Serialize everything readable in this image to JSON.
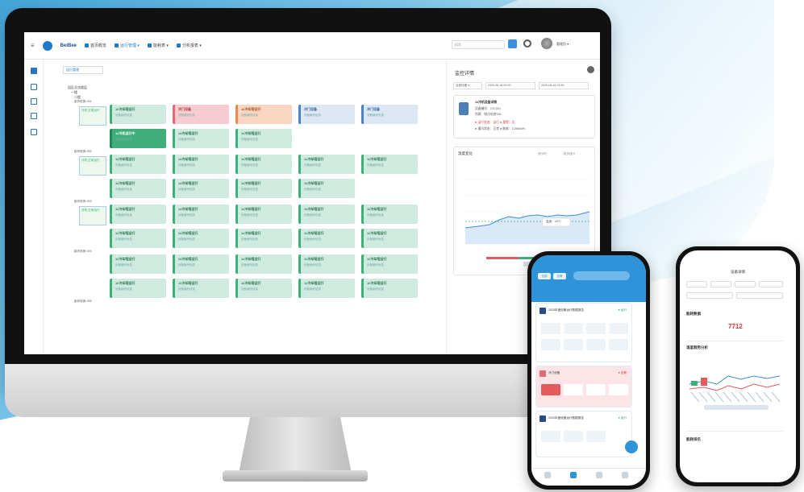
{
  "app": {
    "brand": "BeiBee",
    "nav": [
      {
        "label": "首页概览",
        "active": false
      },
      {
        "label": "运行管理 ▾",
        "active": true
      },
      {
        "label": "能耗表 ▾",
        "active": false
      },
      {
        "label": "分析报表 ▾",
        "active": false
      }
    ],
    "search_placeholder": "搜索",
    "user_name": "管理员 ▾"
  },
  "main": {
    "tab_label": "运行管理",
    "tree": [
      "园区总览楼层",
      "一楼",
      "二楼"
    ],
    "rows": [
      {
        "label": "制冷机房-001",
        "tile": "冷机 正常运行"
      },
      {
        "label": "制冷机房-002",
        "tile": "冷机 正常运行"
      },
      {
        "label": "制冷机房-003",
        "tile": "冷机 正常运行"
      },
      {
        "label": "制冷机房-004",
        "tile": ""
      },
      {
        "label": "制冷机房-005",
        "tile": ""
      }
    ],
    "card_title_default": "1#冷却塔运行",
    "card_sub": "设备编号信息",
    "card_title_alt": "冷门设备",
    "card_title_dark": "1#冷机运行中"
  },
  "right_panel": {
    "title": "监控详情",
    "selects": [
      "全部设备 ▾",
      "2020-06-18 00:00",
      "2020-06-18 23:59"
    ],
    "info": {
      "name": "1#冷机设备详情",
      "lines": [
        "设备编号：CH-001",
        "所属：制冷机房001",
        "● 运行状态：运行  ● 报警：无",
        "● 通讯状态：正常  ● 能耗：1200kWh"
      ]
    },
    "chart": {
      "title": "温度变化",
      "options": [
        "按小时",
        "按天统计"
      ],
      "tooltip": "温度：18°C"
    }
  },
  "phone1": {
    "tabs": [
      "全部",
      "告警"
    ],
    "cards": [
      "2020年度设备运行数据报告",
      "冷门设备",
      "2020年度设备运行数据报告"
    ],
    "status": "● 运行",
    "alarm": "● 告警"
  },
  "phone2": {
    "title": "设备详情",
    "section1": "能耗数据",
    "value": "7712",
    "section2": "温度趋势分析",
    "section3": "能耗排名"
  },
  "colors": {
    "accent": "#1e79c8",
    "green": "#3bb07a",
    "pink": "#e06a7a",
    "orange": "#e58a4d"
  }
}
